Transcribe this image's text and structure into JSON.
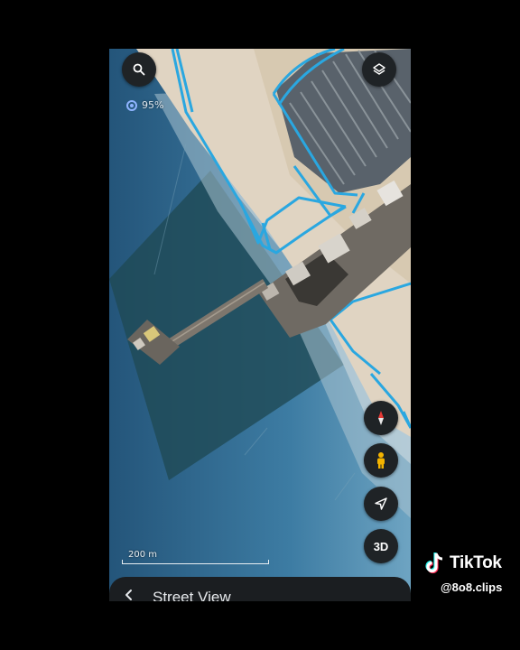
{
  "map": {
    "loading_percent": "95%",
    "scale_label": "200 m"
  },
  "controls": {
    "search_icon": "search-icon",
    "layers_icon": "layers-icon",
    "compass_icon": "compass-icon",
    "pegman_icon": "pegman-icon",
    "location_icon": "navigation-arrow-icon",
    "three_d_label": "3D"
  },
  "sheet": {
    "title": "Street View",
    "back_icon": "chevron-left-icon"
  },
  "watermark": {
    "brand": "TikTok",
    "handle": "@8o8.clips"
  },
  "colors": {
    "road_outline": "#2aa7e0",
    "fab_background": "#1f2326",
    "sheet_background": "#1b1e21"
  }
}
